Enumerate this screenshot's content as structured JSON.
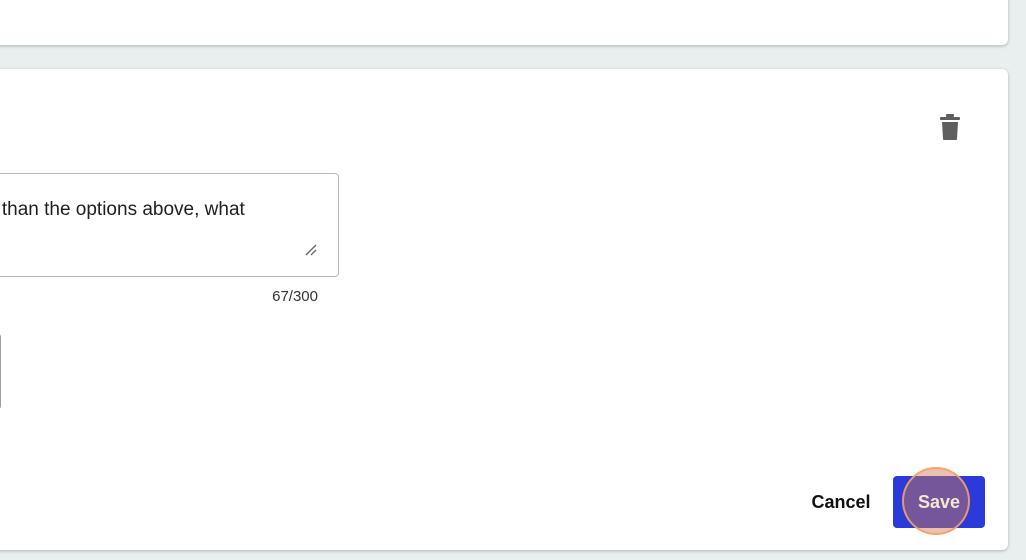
{
  "question": {
    "prompt_text_visible": "e than the options above, what",
    "char_count": "67/300"
  },
  "actions": {
    "cancel_label": "Cancel",
    "save_label": "Save"
  },
  "icons": {
    "delete": "trash-icon",
    "resize": "resize-grip-icon"
  },
  "colors": {
    "background": "#e9eeee",
    "card": "#ffffff",
    "save_button": "#2b3bd9",
    "click_indicator": "#e89a64",
    "trash_icon": "#5f5f5f"
  }
}
